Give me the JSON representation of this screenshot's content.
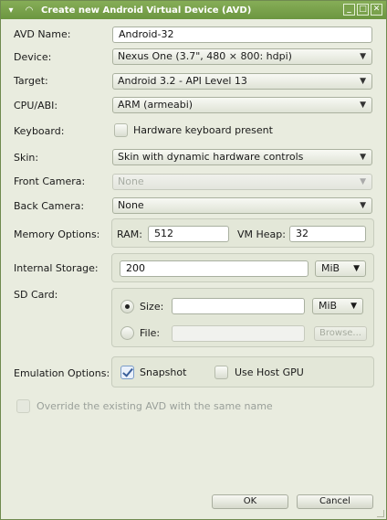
{
  "window": {
    "title": "Create new Android Virtual Device (AVD)",
    "controls": [
      "_",
      "□",
      "✕"
    ]
  },
  "form": {
    "avd_name_label": "AVD Name:",
    "avd_name_value": "Android-32",
    "device_label": "Device:",
    "device_value": "Nexus One (3.7\", 480 × 800: hdpi)",
    "target_label": "Target:",
    "target_value": "Android 3.2 - API Level 13",
    "cpu_label": "CPU/ABI:",
    "cpu_value": "ARM (armeabi)",
    "keyboard_label": "Keyboard:",
    "keyboard_option": "Hardware keyboard present",
    "keyboard_checked": false,
    "skin_label": "Skin:",
    "skin_value": "Skin with dynamic hardware controls",
    "front_camera_label": "Front Camera:",
    "front_camera_value": "None",
    "back_camera_label": "Back Camera:",
    "back_camera_value": "None",
    "memory_label": "Memory Options:",
    "ram_label": "RAM:",
    "ram_value": "512",
    "vm_heap_label": "VM Heap:",
    "vm_heap_value": "32",
    "internal_storage_label": "Internal Storage:",
    "internal_storage_value": "200",
    "internal_storage_unit": "MiB",
    "sd_card_label": "SD Card:",
    "sd_size_label": "Size:",
    "sd_size_value": "",
    "sd_size_unit": "MiB",
    "sd_file_label": "File:",
    "sd_file_value": "",
    "browse_label": "Browse...",
    "emulation_label": "Emulation Options:",
    "snapshot_label": "Snapshot",
    "snapshot_checked": true,
    "host_gpu_label": "Use Host GPU",
    "host_gpu_checked": false,
    "override_label": "Override the existing AVD with the same name"
  },
  "buttons": {
    "ok": "OK",
    "cancel": "Cancel"
  },
  "icons": {
    "window_icon": "android-icon",
    "chevron": "chevron-down-icon"
  }
}
